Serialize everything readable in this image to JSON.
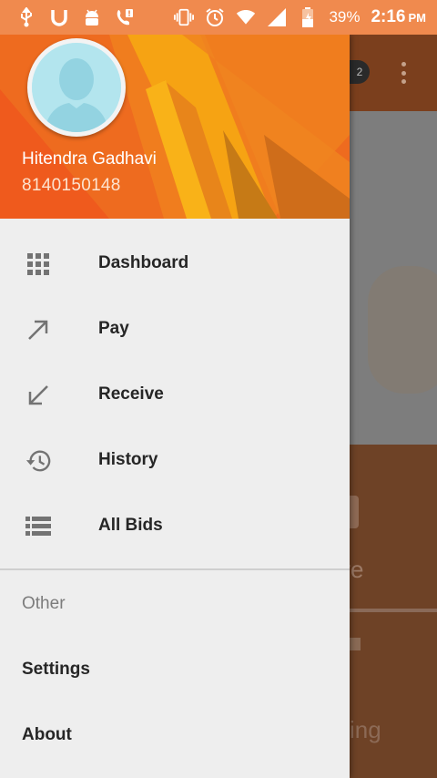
{
  "status_bar": {
    "icons": [
      "usb-icon",
      "u-app-icon",
      "android-debug-icon",
      "call-alert-icon",
      "vibrate-icon",
      "alarm-icon",
      "wifi-icon",
      "cell-signal-icon",
      "battery-icon"
    ],
    "battery": "39%",
    "time": "2:16",
    "ampm": "PM"
  },
  "drawer": {
    "user": {
      "name": "Hitendra Gadhavi",
      "phone": "8140150148"
    },
    "items": [
      {
        "label": "Dashboard",
        "icon": "grid-icon"
      },
      {
        "label": "Pay",
        "icon": "arrow-up-right-icon"
      },
      {
        "label": "Receive",
        "icon": "arrow-down-left-icon"
      },
      {
        "label": "History",
        "icon": "history-icon"
      },
      {
        "label": "All Bids",
        "icon": "list-icon"
      }
    ],
    "section_title": "Other",
    "other_items": [
      {
        "label": "Settings"
      },
      {
        "label": "About"
      }
    ]
  },
  "background_app": {
    "badge": "2",
    "tile1_text": "ve",
    "tile2_text": "ing"
  },
  "colors": {
    "status_bar": "#f08a4e",
    "header_orange": "#ea6a1e",
    "drawer_bg": "#eeeeee",
    "text_primary": "#262626",
    "text_secondary": "#7c7c7c"
  }
}
